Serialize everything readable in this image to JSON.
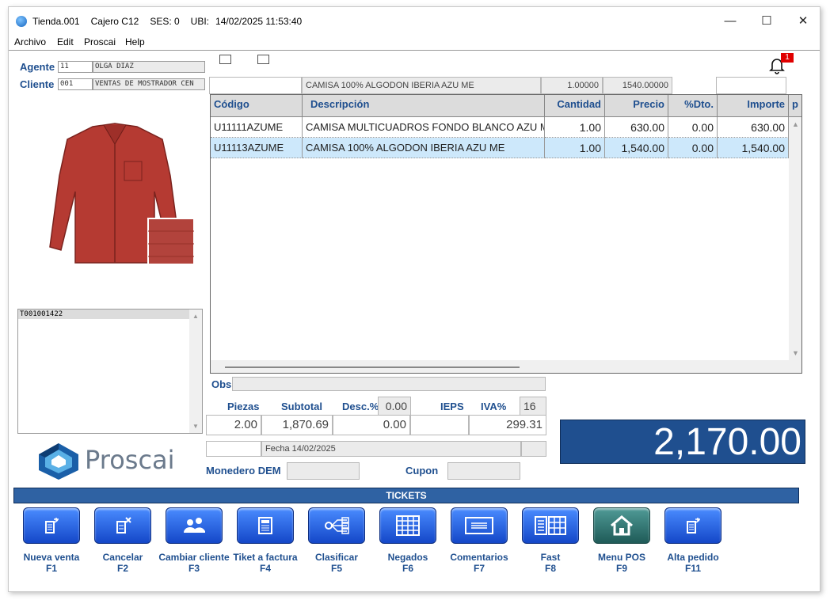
{
  "titlebar": {
    "tienda": "Tienda.001",
    "cajero": "Cajero C12",
    "ses": "SES: 0",
    "ubi": "UBI:",
    "datetime": "14/02/2025 11:53:40"
  },
  "menu": [
    "Archivo",
    "Edit",
    "Proscai",
    "Help"
  ],
  "agente": {
    "label": "Agente",
    "code": "11",
    "name": "OLGA DIAZ"
  },
  "cliente": {
    "label": "Cliente",
    "code": "001",
    "name": "VENTAS DE MOSTRADOR CEN"
  },
  "notification_count": "1",
  "entry": {
    "code": "",
    "desc": "CAMISA 100% ALGODON IBERIA AZU ME",
    "qty": "1.00000",
    "price": "1540.00000",
    "extra": ""
  },
  "grid": {
    "headers": [
      "Código",
      "Descripción",
      "Cantidad",
      "Precio",
      "%Dto.",
      "Importe",
      "p"
    ],
    "rows": [
      {
        "codigo": "U11111AZUME",
        "descripcion": "CAMISA MULTICUADROS FONDO BLANCO AZU ME",
        "cantidad": "1.00",
        "precio": "630.00",
        "dto": "0.00",
        "importe": "630.00"
      },
      {
        "codigo": "U11113AZUME",
        "descripcion": "CAMISA 100% ALGODON IBERIA AZU ME",
        "cantidad": "1.00",
        "precio": "1,540.00",
        "dto": "0.00",
        "importe": "1,540.00"
      }
    ]
  },
  "ticket_list": [
    "T001001422"
  ],
  "brand": "Proscai",
  "obs_label": "Obs",
  "totals": {
    "piezas_label": "Piezas",
    "piezas": "2.00",
    "subtotal_label": "Subtotal",
    "subtotal": "1,870.69",
    "desc_label": "Desc.%",
    "desc_pct": "0.00",
    "desc": "0.00",
    "ieps_label": "IEPS",
    "ieps": "",
    "iva_label": "IVA%",
    "iva_pct": "16",
    "iva": "299.31",
    "total": "2,170.00"
  },
  "fecha": "Fecha 14/02/2025",
  "monedero_label": "Monedero DEM",
  "cupon_label": "Cupon",
  "tickets_bar": "TICKETS",
  "buttons": [
    {
      "label": "Nueva venta",
      "key": "F1",
      "icon": "new-sale-icon"
    },
    {
      "label": "Cancelar",
      "key": "F2",
      "icon": "cancel-doc-icon"
    },
    {
      "label": "Cambiar cliente",
      "key": "F3",
      "icon": "users-icon"
    },
    {
      "label": "Tiket a factura",
      "key": "F4",
      "icon": "invoice-icon"
    },
    {
      "label": "Clasificar",
      "key": "F5",
      "icon": "classify-icon"
    },
    {
      "label": "Negados",
      "key": "F6",
      "icon": "grid-icon"
    },
    {
      "label": "Comentarios",
      "key": "F7",
      "icon": "comments-icon"
    },
    {
      "label": "Fast",
      "key": "F8",
      "icon": "fast-icon"
    },
    {
      "label": "Menu POS",
      "key": "F9",
      "icon": "home-icon"
    },
    {
      "label": "Alta pedido",
      "key": "F11",
      "icon": "new-order-icon"
    }
  ]
}
